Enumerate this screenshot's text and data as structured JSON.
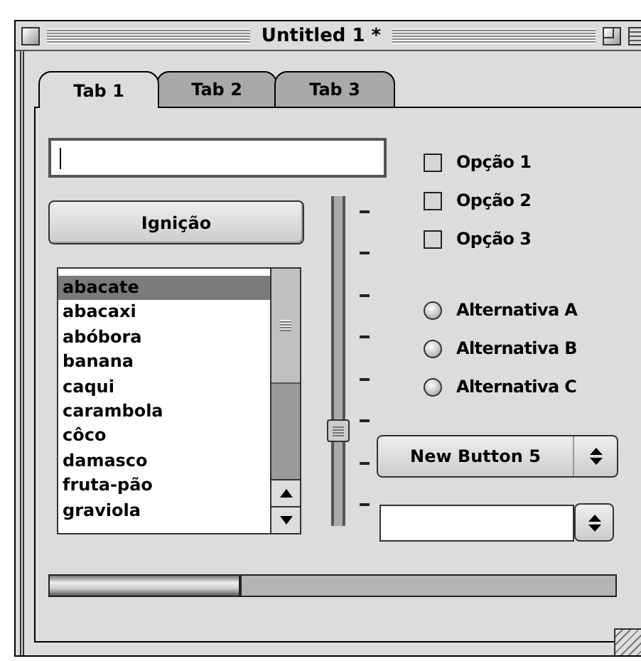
{
  "window": {
    "title": "Untitled 1 *"
  },
  "tabs": [
    {
      "label": "Tab 1",
      "selected": true
    },
    {
      "label": "Tab 2",
      "selected": false
    },
    {
      "label": "Tab 3",
      "selected": false
    }
  ],
  "text_field": {
    "focused": true
  },
  "button": {
    "label": "Ignição"
  },
  "list": {
    "items": [
      {
        "label": "abacate",
        "selected": true
      },
      {
        "label": "abacaxi",
        "selected": false
      },
      {
        "label": "abóbora",
        "selected": false
      },
      {
        "label": "banana",
        "selected": false
      },
      {
        "label": "caqui",
        "selected": false
      },
      {
        "label": "carambola",
        "selected": false
      },
      {
        "label": "côco",
        "selected": false
      },
      {
        "label": "damasco",
        "selected": false
      },
      {
        "label": "fruta-pão",
        "selected": false
      },
      {
        "label": "graviola",
        "selected": false
      }
    ]
  },
  "slider": {
    "level": 0.29
  },
  "checkboxes": [
    {
      "label": "Opção 1",
      "checked": false
    },
    {
      "label": "Opção 2",
      "checked": false
    },
    {
      "label": "Opção 3",
      "checked": false
    }
  ],
  "radios": [
    {
      "label": "Alternativa A",
      "selected": false
    },
    {
      "label": "Alternativa B",
      "selected": false
    },
    {
      "label": "Alternativa C",
      "selected": false
    }
  ],
  "popup_button": {
    "label": "New Button 5"
  },
  "progress_bar": {
    "level": 0.34
  }
}
